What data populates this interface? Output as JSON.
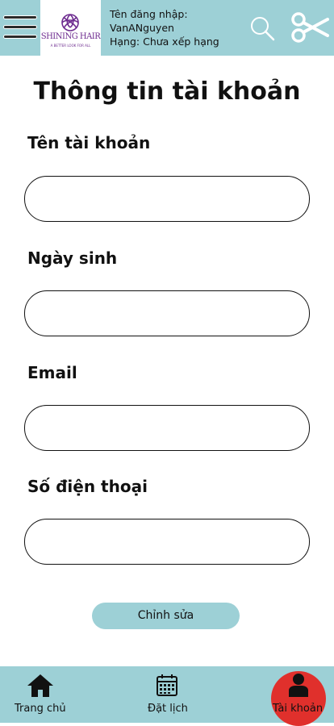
{
  "header": {
    "menu_icon": "hamburger-menu-icon",
    "logo": {
      "brand": "SHINING HAIR",
      "tagline": "A BETTER LOOK FOR ALL"
    },
    "user": {
      "username_label": "Tên đăng nhập:",
      "username": "VanANguyen",
      "rank": "Hạng: Chưa xếp hạng"
    },
    "search_icon": "search-icon",
    "scissors_icon": "scissors-icon"
  },
  "main": {
    "title": "Thông tin tài khoản",
    "fields": [
      {
        "label": "Tên tài khoản",
        "value": ""
      },
      {
        "label": "Ngày sinh",
        "value": ""
      },
      {
        "label": "Email",
        "value": ""
      },
      {
        "label": "Số điện thoại",
        "value": ""
      }
    ],
    "edit_button": "Chỉnh sửa"
  },
  "nav": {
    "items": [
      {
        "label": "Trang chủ",
        "icon": "home-icon"
      },
      {
        "label": "Đặt lịch",
        "icon": "calendar-icon"
      },
      {
        "label": "Tài khoản",
        "icon": "user-icon",
        "active": true
      }
    ]
  },
  "colors": {
    "accent": "#9dd0d6",
    "active": "#e0302c",
    "brand": "#6d2b8f"
  }
}
